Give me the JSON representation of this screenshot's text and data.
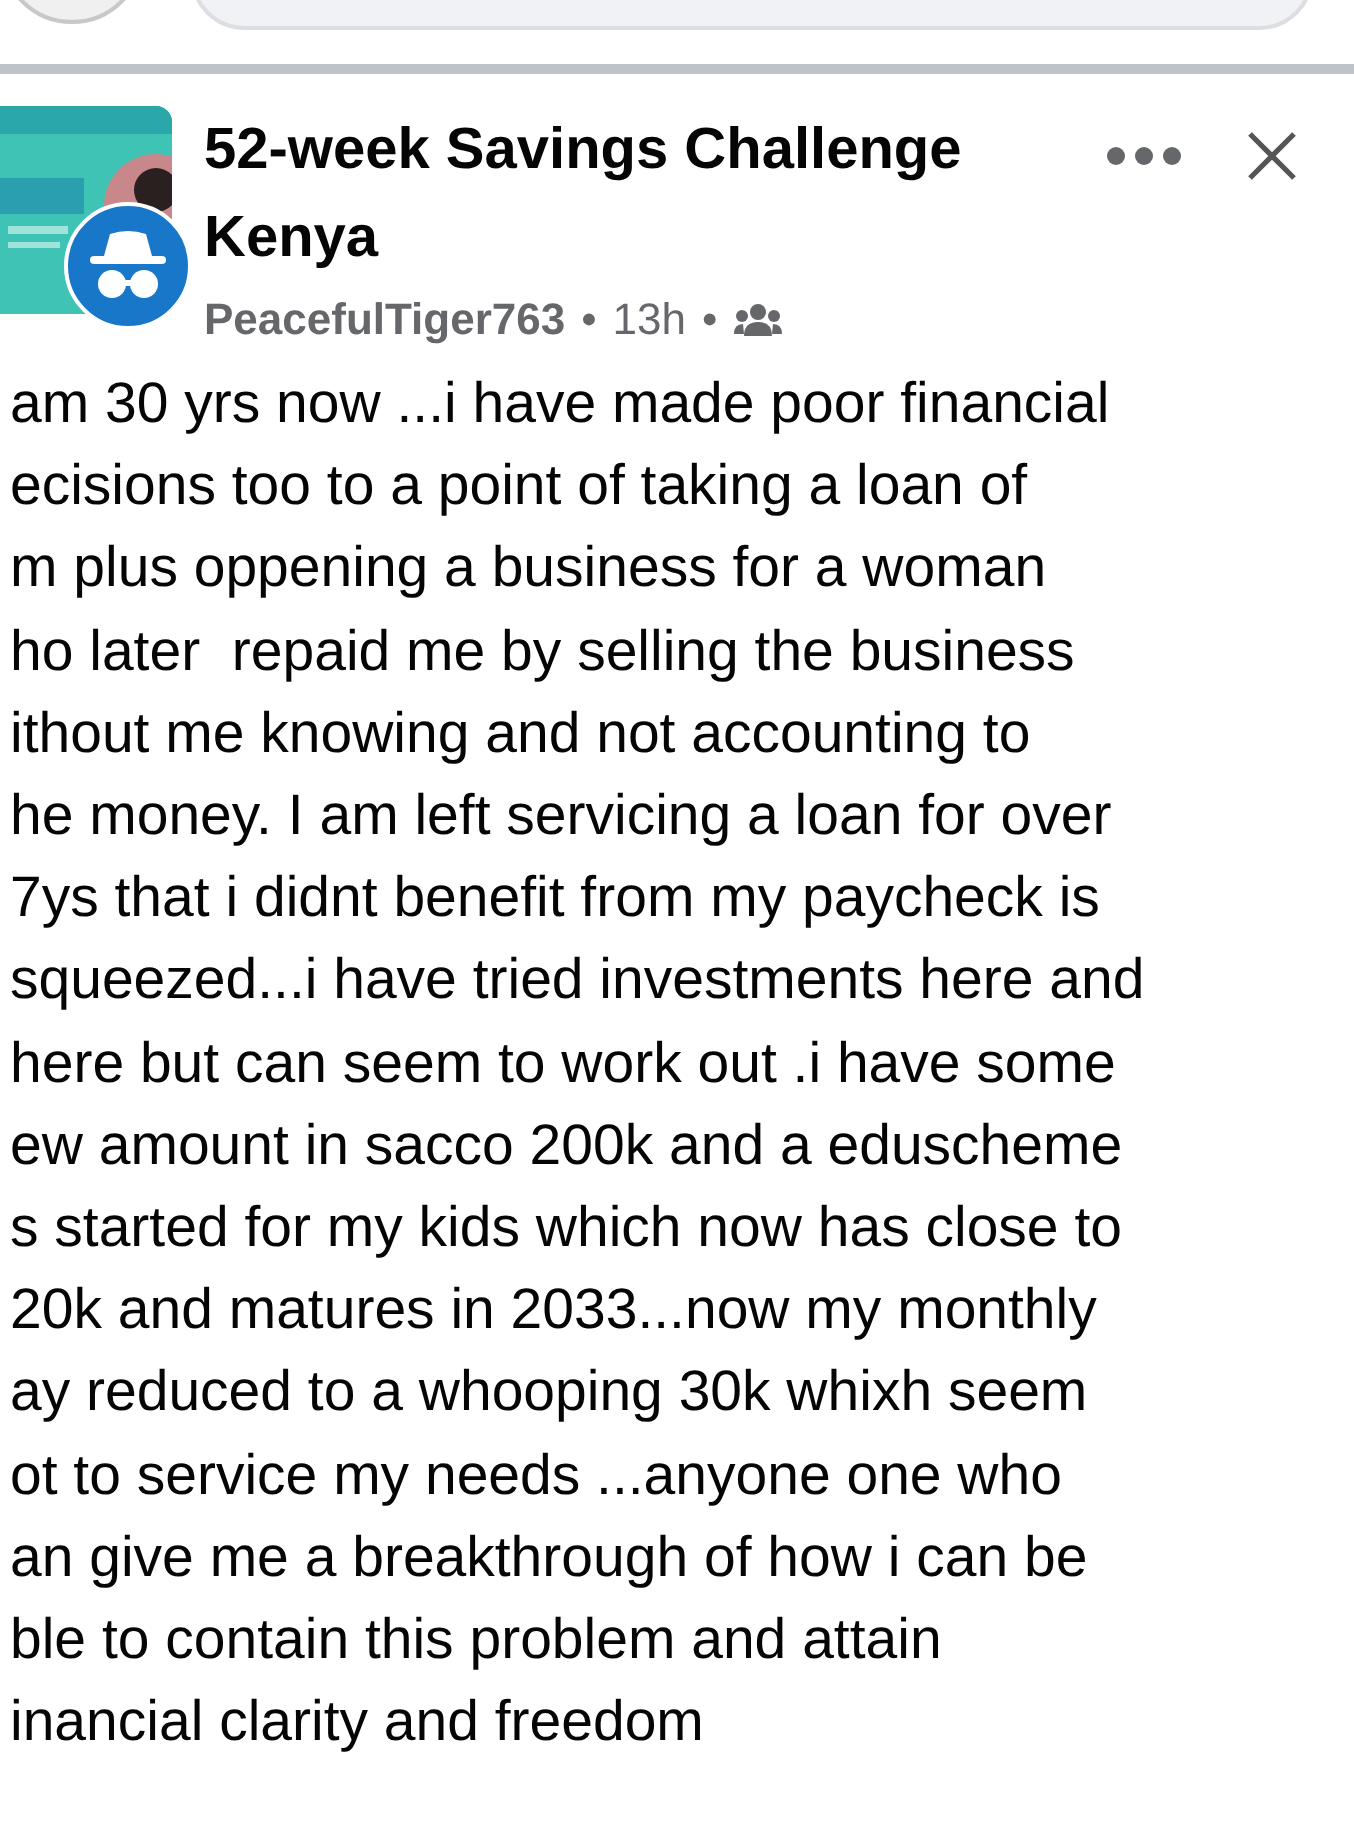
{
  "post": {
    "group_name": "52-week Savings Challenge Kenya",
    "author": "PeacefulTiger763",
    "separator": "•",
    "time": "13h",
    "body_lines": [
      "am 30 yrs now ...i have made poor financial",
      "ecisions too to a point of taking a loan of",
      "m plus oppening a business for a woman",
      "ho later  repaid me by selling the business",
      "ithout me knowing and not accounting to",
      "he money. I am left servicing a loan for over",
      "7ys that i didnt benefit from my paycheck is",
      "squeezed...i have tried investments here and",
      "here but can seem to work out .i have some",
      "ew amount in sacco 200k and a eduscheme",
      "s started for my kids which now has close to",
      "20k and matures in 2033...now my monthly",
      "ay reduced to a whooping 30k whixh seem",
      "ot to service my needs ...anyone one who",
      "an give me a breakthrough of how i can be",
      "ble to contain this problem and attain",
      "inancial clarity and freedom"
    ]
  }
}
